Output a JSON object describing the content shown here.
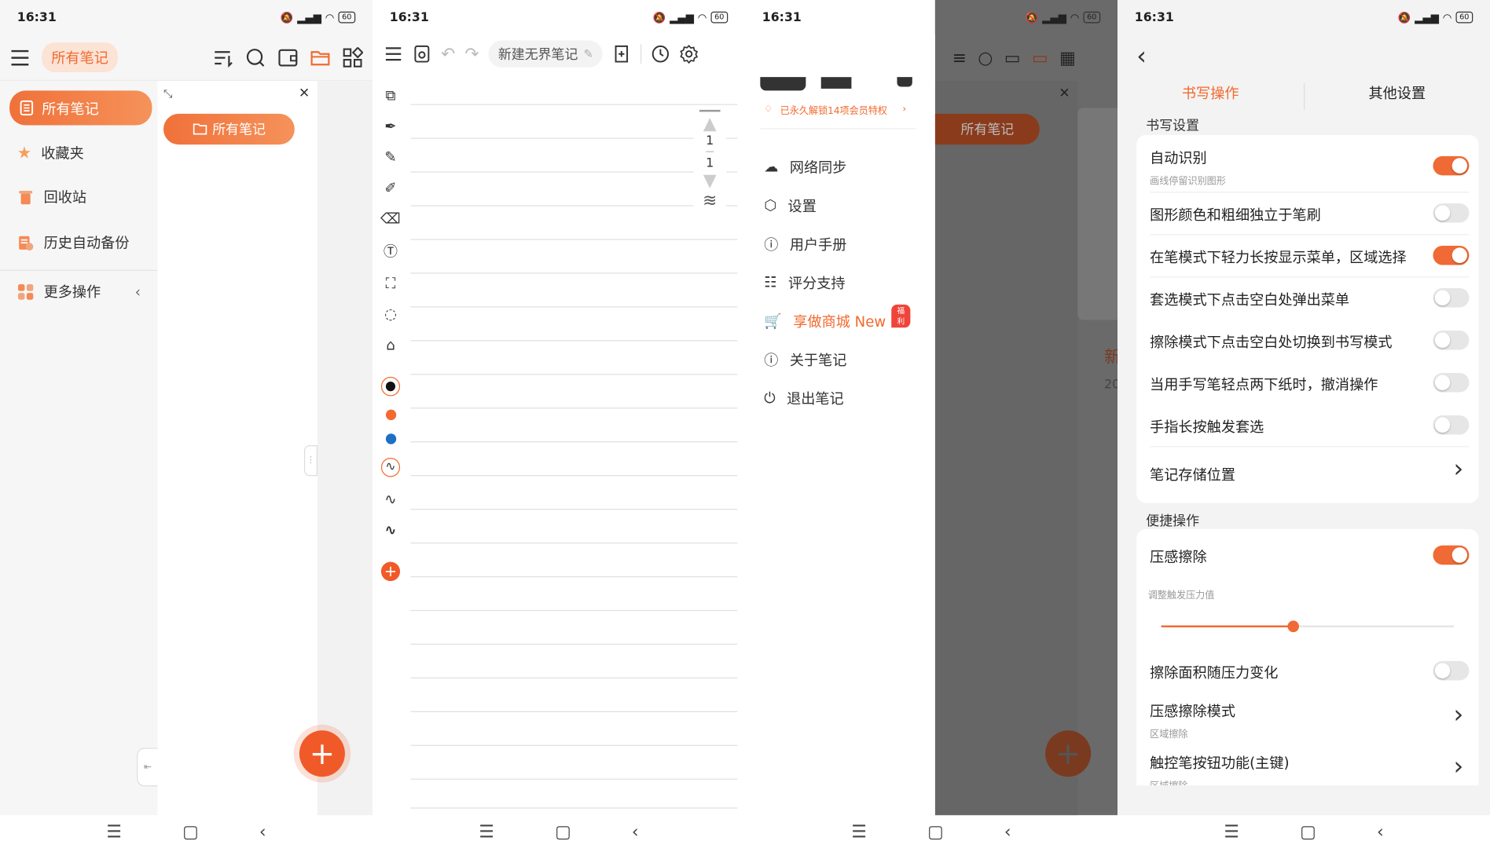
{
  "status": {
    "time": "16:31",
    "battery": "60"
  },
  "screen1": {
    "header_title": "所有笔记",
    "sidebar": [
      {
        "label": "所有笔记",
        "icon": "notes-icon",
        "active": true
      },
      {
        "label": "收藏夹",
        "icon": "star-icon"
      },
      {
        "label": "回收站",
        "icon": "trash-icon"
      },
      {
        "label": "历史自动备份",
        "icon": "backup-icon"
      },
      {
        "label": "更多操作",
        "icon": "grid-icon"
      }
    ],
    "folder_label": "所有笔记"
  },
  "screen2": {
    "note_title": "新建无界笔记",
    "page_top": "1",
    "page_bottom": "1"
  },
  "screen3": {
    "member_text": "已永久解锁14项会员特权",
    "menu": [
      {
        "label": "网络同步",
        "icon": "cloud-sync-icon"
      },
      {
        "label": "设置",
        "icon": "gear-icon"
      },
      {
        "label": "用户手册",
        "icon": "help-icon"
      },
      {
        "label": "评分支持",
        "icon": "rate-icon"
      },
      {
        "label": "享做商城 New",
        "icon": "cart-icon",
        "highlight": true,
        "badge": "福利"
      },
      {
        "label": "关于笔记",
        "icon": "info-icon"
      },
      {
        "label": "退出笔记",
        "icon": "power-icon"
      }
    ],
    "bg_folder_label": "所有笔记",
    "bg_partial_1": "新",
    "bg_partial_2": "20"
  },
  "screen4": {
    "tabs": [
      "书写操作",
      "其他设置"
    ],
    "section1_title": "书写设置",
    "section1": [
      {
        "label": "自动识别",
        "sub": "画线停留识别图形",
        "on": true
      },
      {
        "label": "图形颜色和粗细独立于笔刷",
        "on": false
      },
      {
        "label": "在笔模式下轻力长按显示菜单，区域选择",
        "on": true
      },
      {
        "label": "套选模式下点击空白处弹出菜单",
        "on": false
      },
      {
        "label": "擦除模式下点击空白处切换到书写模式",
        "on": false
      },
      {
        "label": "当用手写笔轻点两下纸时，撤消操作",
        "on": false
      },
      {
        "label": "手指长按触发套选",
        "on": false
      }
    ],
    "storage_label": "笔记存储位置",
    "section2_title": "便捷操作",
    "pressure_erase": {
      "label": "压感擦除",
      "on": true
    },
    "slider_label": "调整触发压力值",
    "slider_value": 0.45,
    "area_pressure": {
      "label": "擦除面积随压力变化",
      "on": false
    },
    "erase_mode": {
      "label": "压感擦除模式",
      "sub": "区域擦除"
    },
    "pen_button": {
      "label": "触控笔按钮功能(主键)",
      "sub": "区域擦除"
    }
  }
}
